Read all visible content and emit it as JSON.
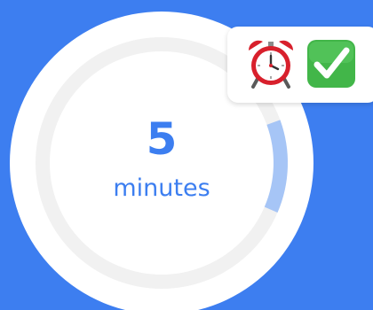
{
  "timer": {
    "value": "5",
    "unit": "minutes",
    "progress": 0.12,
    "track_color": "#f1f1f1",
    "progress_color": "#a6c5f6",
    "accent": "#3c7ef0"
  },
  "badge": {
    "icons": [
      "alarm-clock-icon",
      "check-mark-button-icon"
    ]
  },
  "background": "#3d7ef0"
}
